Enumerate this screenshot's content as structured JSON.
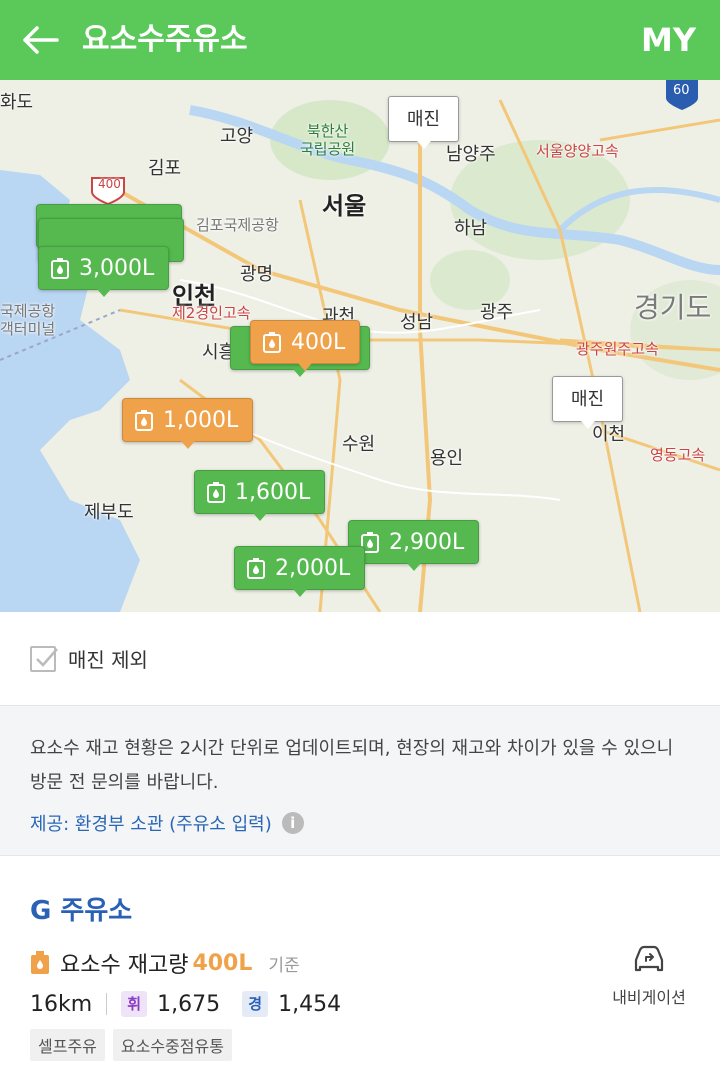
{
  "header": {
    "title": "요소수주유소",
    "my_label": "MY"
  },
  "map": {
    "places": {
      "hwado": "화도",
      "goyang": "고양",
      "bukhansan": "북한산\n국립공원",
      "gimpo": "김포",
      "seoul": "서울",
      "namyangju": "남양주",
      "gimpo_airport": "김포국제공항",
      "hanam": "하남",
      "gwangmyeong": "광명",
      "incheon": "인천",
      "gyeonggi": "경기도",
      "airport_terminal": "국제공항\n객터미널",
      "2nd_highway": "제2경인고속",
      "gwacheon": "과천",
      "seongnam": "성남",
      "gwangju": "광주",
      "siheung": "시흥",
      "gwangju_wonju": "광주원주고속",
      "suwon": "수원",
      "yongin": "용인",
      "icheon": "이천",
      "yeongdong": "영동고속",
      "jebudo": "제부도",
      "seoul_yangyang": "서울양양고속",
      "route_400": "400",
      "route_60": "60"
    },
    "markers": [
      {
        "id": "m3000",
        "label": "3,000L",
        "status": "normal"
      },
      {
        "id": "m400",
        "label": "400L",
        "status": "low"
      },
      {
        "id": "m1000",
        "label": "1,000L",
        "status": "low"
      },
      {
        "id": "m1600",
        "label": "1,600L",
        "status": "normal"
      },
      {
        "id": "m2900",
        "label": "2,900L",
        "status": "normal"
      },
      {
        "id": "m2000",
        "label": "2,000L",
        "status": "normal"
      }
    ],
    "soldout_label": "매진",
    "colors": {
      "normal": "#55b94f",
      "low": "#f0a24a"
    }
  },
  "filter": {
    "exclude_soldout_label": "매진 제외",
    "checked": true
  },
  "notice": {
    "text": "요소수 재고 현황은 2시간 단위로 업데이트되며, 현장의 재고와 차이가 있을 수 있으니 방문 전 문의를 바랍니다.",
    "source": "제공: 환경부 소관 (주유소 입력)"
  },
  "station": {
    "name": "G 주유소",
    "stock_label": "요소수 재고량",
    "stock_value": "400L",
    "stock_base": "기준",
    "distance": "16km",
    "gasoline_badge": "휘",
    "gasoline_price": "1,675",
    "diesel_badge": "경",
    "diesel_price": "1,454",
    "tags": [
      "셀프주유",
      "요소수중점유통"
    ],
    "navigation_label": "내비게이션"
  }
}
